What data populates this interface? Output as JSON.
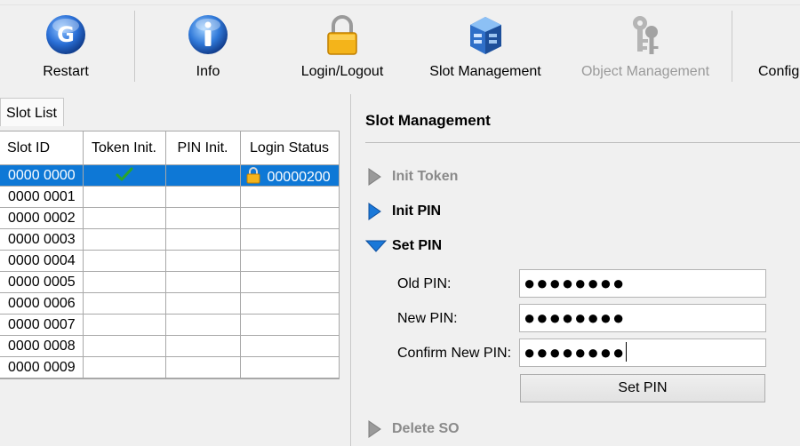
{
  "toolbar": {
    "buttons": [
      {
        "label": "Restart",
        "icon": "restart-icon",
        "enabled": true
      },
      {
        "label": "Info",
        "icon": "info-icon",
        "enabled": true
      },
      {
        "label": "Login/Logout",
        "icon": "padlock-icon",
        "enabled": true
      },
      {
        "label": "Slot Management",
        "icon": "slot-management-icon",
        "enabled": true
      },
      {
        "label": "Object Management",
        "icon": "keys-icon",
        "enabled": false
      },
      {
        "label": "Config",
        "icon": "config-icon",
        "enabled": true
      }
    ]
  },
  "slot_list": {
    "tab_label": "Slot List",
    "columns": [
      "Slot ID",
      "Token Init.",
      "PIN Init.",
      "Login Status"
    ],
    "rows": [
      {
        "slot_id": "0000 0000",
        "token_init": "checkmark-icon",
        "pin_init": "",
        "login_status": "00000200",
        "login_icon": "padlock-icon",
        "selected": true
      },
      {
        "slot_id": "0000 0001",
        "token_init": "",
        "pin_init": "",
        "login_status": ""
      },
      {
        "slot_id": "0000 0002",
        "token_init": "",
        "pin_init": "",
        "login_status": ""
      },
      {
        "slot_id": "0000 0003",
        "token_init": "",
        "pin_init": "",
        "login_status": ""
      },
      {
        "slot_id": "0000 0004",
        "token_init": "",
        "pin_init": "",
        "login_status": ""
      },
      {
        "slot_id": "0000 0005",
        "token_init": "",
        "pin_init": "",
        "login_status": ""
      },
      {
        "slot_id": "0000 0006",
        "token_init": "",
        "pin_init": "",
        "login_status": ""
      },
      {
        "slot_id": "0000 0007",
        "token_init": "",
        "pin_init": "",
        "login_status": ""
      },
      {
        "slot_id": "0000 0008",
        "token_init": "",
        "pin_init": "",
        "login_status": ""
      },
      {
        "slot_id": "0000 0009",
        "token_init": "",
        "pin_init": "",
        "login_status": ""
      }
    ]
  },
  "slot_management": {
    "title": "Slot Management",
    "sections": [
      {
        "label": "Init Token",
        "state": "collapsed",
        "enabled": false
      },
      {
        "label": "Init PIN",
        "state": "collapsed",
        "enabled": true
      },
      {
        "label": "Set PIN",
        "state": "expanded",
        "enabled": true
      },
      {
        "label": "Delete SO",
        "state": "collapsed",
        "enabled": false
      }
    ],
    "set_pin": {
      "old_pin_label": "Old PIN:",
      "old_pin_value": "●●●●●●●●",
      "new_pin_label": "New PIN:",
      "new_pin_value": "●●●●●●●●",
      "confirm_pin_label": "Confirm New PIN:",
      "confirm_pin_value": "●●●●●●●●",
      "button_label": "Set PIN"
    }
  },
  "colors": {
    "selection": "#0e78d6",
    "arrow_active": "#1a78d8",
    "arrow_disabled": "#9a9a9a",
    "check": "#2aa52a"
  }
}
